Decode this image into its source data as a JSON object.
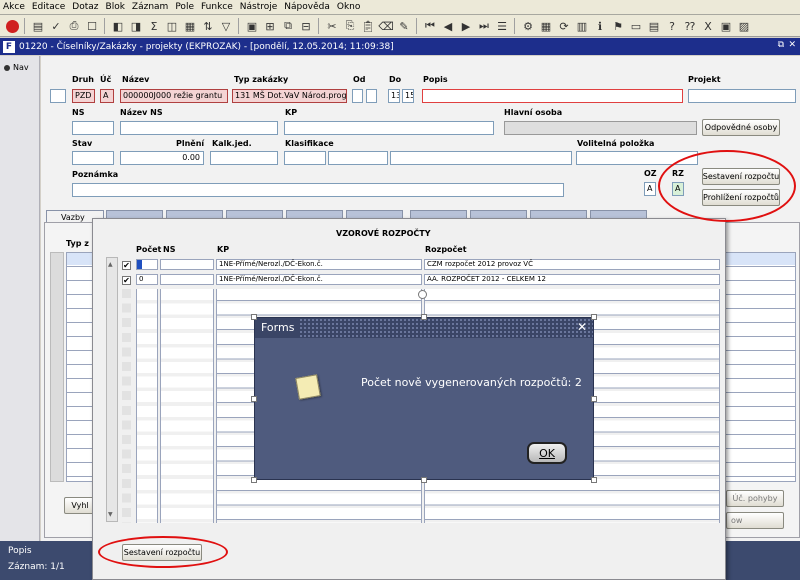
{
  "menu": [
    "Akce",
    "Editace",
    "Dotaz",
    "Blok",
    "Záznam",
    "Pole",
    "Funkce",
    "Nástroje",
    "Nápověda",
    "Okno"
  ],
  "window": {
    "title": "01220 - Číselníky/Zakázky - projekty (EKPROZAK) - [pondělí, 12.05.2014; 11:09:38]",
    "nav_label": "Nav"
  },
  "form": {
    "labels": {
      "druh": "Druh",
      "uc": "Úč",
      "nazev": "Název",
      "typ": "Typ zakázky",
      "od": "Od",
      "do": "Do",
      "popis": "Popis",
      "projekt": "Projekt",
      "ns": "NS",
      "nazev_ns": "Název NS",
      "kp": "KP",
      "hlavni": "Hlavní osoba",
      "stav": "Stav",
      "plneni": "Plnění",
      "kalk": "Kalk.jed.",
      "klas": "Klasifikace",
      "volitelna": "Volitelná položka",
      "poznamka": "Poznámka",
      "oz": "OZ",
      "rz": "RZ"
    },
    "values": {
      "druh": "PZD",
      "uc": "A",
      "nazev": "000000J000 režie grantu",
      "typ": "131 MŠ Dot.VaV Národ.prog",
      "do1": "13",
      "do2": "15",
      "plneni": "0.00",
      "oz": "A",
      "rz": "A"
    },
    "buttons": {
      "odpovedne": "Odpovědné osoby",
      "sestaveni": "Sestavení rozpočtu",
      "prohlizeni": "Prohlížení rozpočtů"
    }
  },
  "lower": {
    "tab_first": "Vazby",
    "col_typ": "Typ z",
    "vyhl": "Vyhl",
    "uc_pohyby": "Úč. pohyby",
    "pohyby2": "ow"
  },
  "dialog": {
    "title": "VZOROVÉ ROZPOČTY",
    "headers": {
      "pocet": "Počet",
      "ns": "NS",
      "kp": "KP",
      "rozpocet": "Rozpočet"
    },
    "rows": [
      {
        "checked": true,
        "pocet": "0",
        "ns": "",
        "kp": "1NE-Přímé/Nerozl./DČ-Ekon.č.",
        "rozpocet": "CZM rozpočet 2012 provoz VČ"
      },
      {
        "checked": true,
        "pocet": "0",
        "ns": "",
        "kp": "1NE-Přímé/Nerozl./DČ-Ekon.č.",
        "rozpocet": "AA. ROZPOČET 2012 - CELKEM 12"
      }
    ],
    "button": "Sestavení rozpočtu"
  },
  "modal": {
    "title": "Forms",
    "message": "Počet nově vygenerovaných rozpočtů: 2",
    "ok": "OK"
  },
  "status": {
    "field": "Popis",
    "record": "Záznam: 1/1"
  },
  "colors": {
    "title_bar": "#1d2e8c",
    "modal_bg": "#4f5b7e",
    "annotation": "#e01010"
  }
}
